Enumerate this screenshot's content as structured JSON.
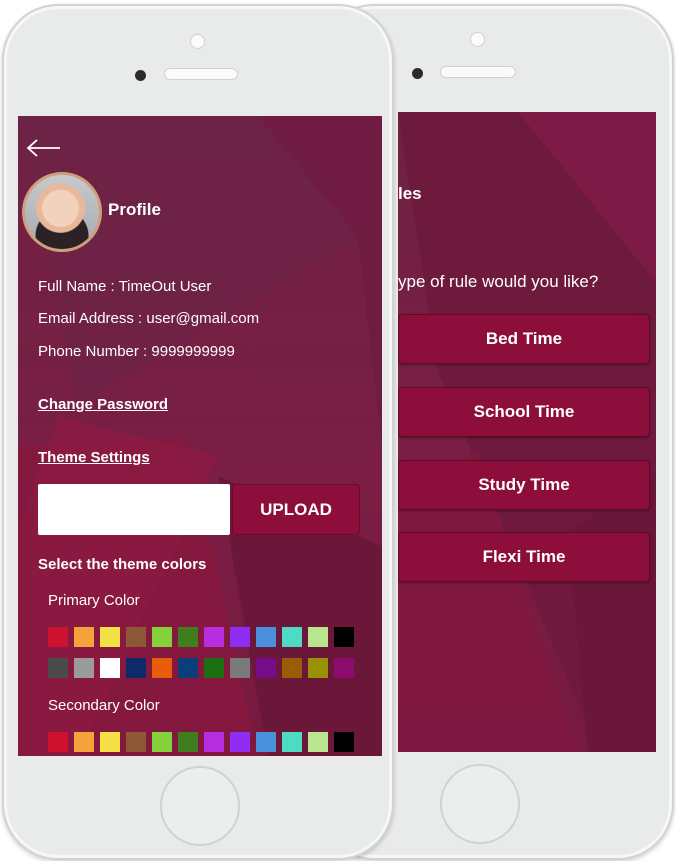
{
  "colors": {
    "accent": "#8d0e3b",
    "background": "#6e2243"
  },
  "profile_screen": {
    "back_icon": "back-arrow-icon",
    "title": "Profile",
    "full_name": "Full Name : TimeOut User",
    "email": "Email Address : user@gmail.com",
    "phone": "Phone Number : 9999999999",
    "change_password": "Change Password",
    "theme_settings": "Theme Settings",
    "upload_value": "",
    "upload_label": "UPLOAD",
    "select_colors": "Select the theme colors",
    "primary_label": "Primary Color",
    "secondary_label": "Secondary Color",
    "primary_row1": [
      "#cf1130",
      "#f4a33a",
      "#f4e146",
      "#8c5836",
      "#84d13b",
      "#3f7d1e",
      "#b62ee0",
      "#8f2ef2",
      "#4b90dd",
      "#4edbc4",
      "#b9e58f",
      "#000000"
    ],
    "primary_row2": [
      "#4a4a4a",
      "#9b9b9b",
      "#ffffff",
      "#0e2a6b",
      "#e85d0c",
      "#0b3f7a",
      "#1c6f12",
      "#7a7a7a",
      "#760c89",
      "#9a5d05",
      "#9a9205",
      "#8e0c6c"
    ],
    "secondary_row1": [
      "#cf1130",
      "#f4a33a",
      "#f4e146",
      "#8c5836",
      "#84d13b",
      "#3f7d1e",
      "#b62ee0",
      "#8f2ef2",
      "#4b90dd",
      "#4edbc4",
      "#b9e58f",
      "#000000"
    ]
  },
  "rules_screen": {
    "title_partial": "les",
    "question_partial": "ype of rule would you like?",
    "buttons": [
      "Bed Time",
      "School Time",
      "Study Time",
      "Flexi Time"
    ]
  }
}
